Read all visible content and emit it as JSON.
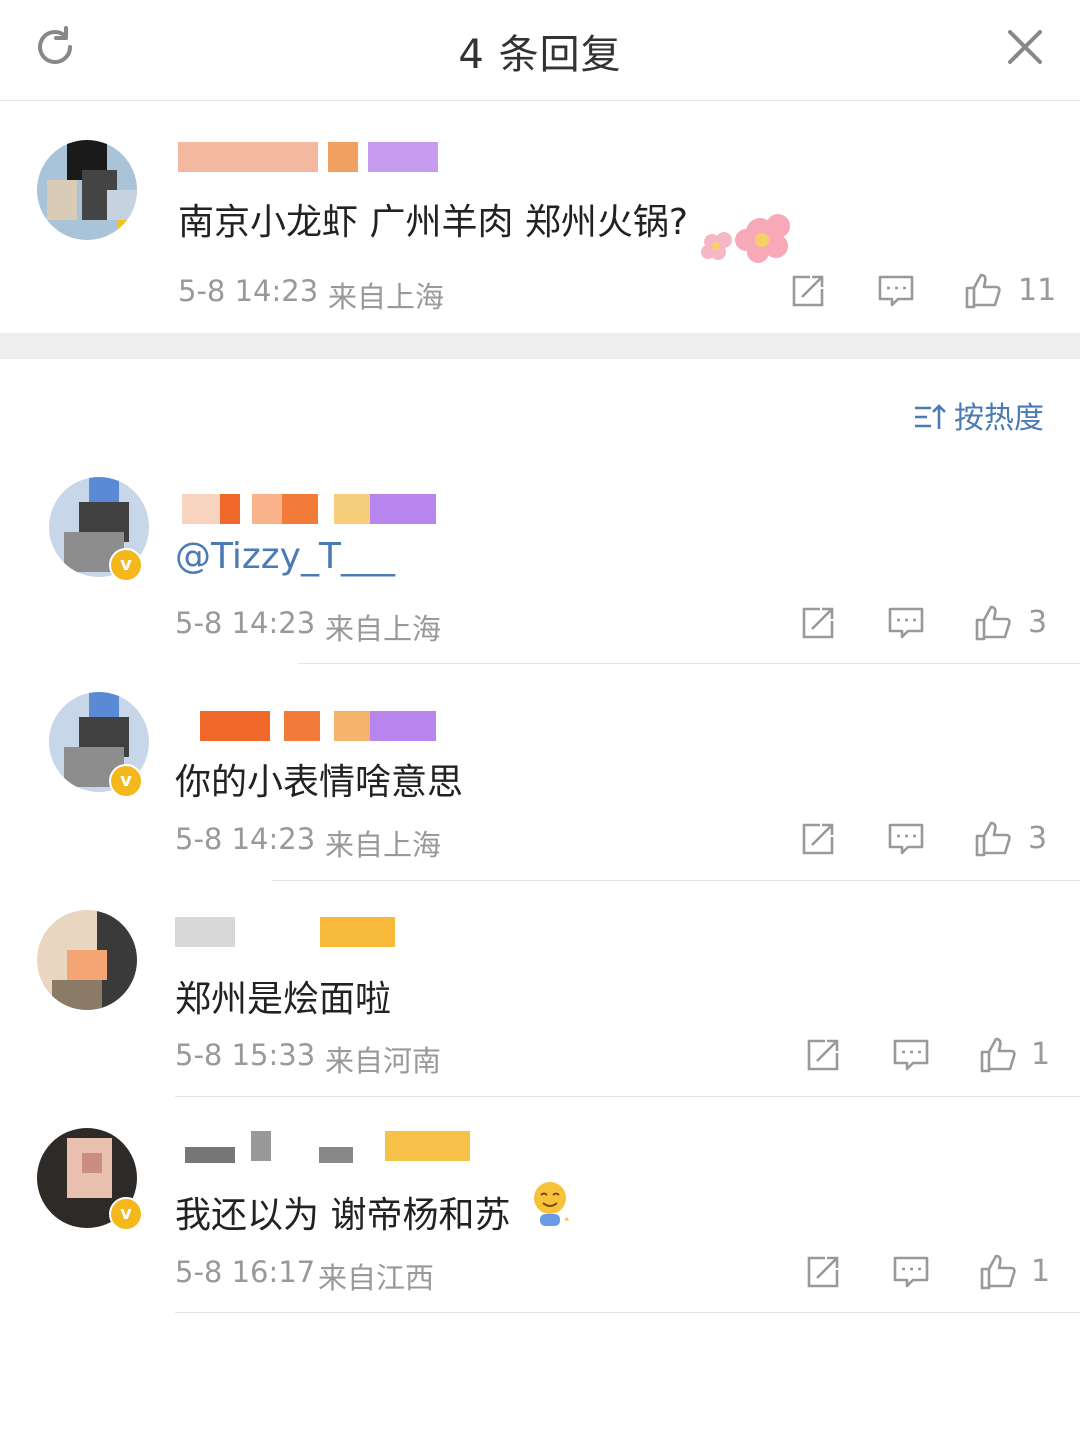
{
  "header": {
    "title": "4 条回复"
  },
  "root_comment": {
    "content": "南京小龙虾 广州羊肉 郑州火锅?",
    "time": "5-8 14:23",
    "location": "来自上海",
    "likes": "11"
  },
  "sort": {
    "label": "按热度"
  },
  "replies": [
    {
      "content": "@Tizzy_T___",
      "time": "5-8 14:23",
      "location": "来自上海",
      "likes": "3"
    },
    {
      "content": "你的小表情啥意思",
      "time": "5-8 14:23",
      "location": "来自上海",
      "likes": "3"
    },
    {
      "content": "郑州是烩面啦",
      "time": "5-8 15:33",
      "location": "来自河南",
      "likes": "1"
    },
    {
      "content": "我还以为 谢帝杨和苏",
      "time": "5-8 16:17",
      "location": "来自江西",
      "likes": "1"
    }
  ],
  "colors": {
    "link": "#4b7bb4",
    "meta": "#999999",
    "badge": "#f5b81c"
  },
  "icons": [
    "refresh-icon",
    "close-icon",
    "share-icon",
    "comment-icon",
    "like-icon",
    "sort-icon"
  ]
}
